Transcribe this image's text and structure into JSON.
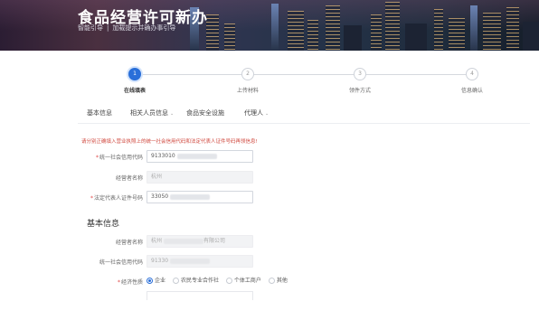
{
  "banner": {
    "title": "食品经营许可新办",
    "sub_left": "智能引导",
    "sub_sep": "|",
    "sub_right": "加载提示并确办事引导"
  },
  "stepper": {
    "steps": [
      {
        "num": "1",
        "label": "在线填表",
        "active": true
      },
      {
        "num": "2",
        "label": "上传材料",
        "active": false
      },
      {
        "num": "3",
        "label": "领件方式",
        "active": false
      },
      {
        "num": "4",
        "label": "信息确认",
        "active": false
      }
    ]
  },
  "tabs": {
    "items": [
      {
        "label": "基本信息",
        "caret": ""
      },
      {
        "label": "相关人员信息",
        "caret": "⌄"
      },
      {
        "label": "食品安全设施",
        "caret": ""
      },
      {
        "label": "代理人",
        "caret": "⌄"
      }
    ]
  },
  "form": {
    "notice": "请分别正确填入营业执照上的统一社会信用代码和法定代表人证件号码再领信息!",
    "credit_code_label": "统一社会信用代码",
    "credit_code_value": "9133010",
    "operator_name_label": "经营者名称",
    "operator_name_value": "杭州",
    "legal_id_label": "法定代表人证件号码",
    "legal_id_value": "33050",
    "section_title": "基本信息",
    "basic_operator_label": "经营者名称",
    "basic_operator_value": "杭州",
    "basic_operator_suffix": "有限公司",
    "basic_credit_label": "统一社会信用代码",
    "basic_credit_value": "91330",
    "econ_label": "经济性质",
    "econ_options": [
      "企业",
      "农民专业合作社",
      "个体工商户",
      "其他"
    ]
  }
}
